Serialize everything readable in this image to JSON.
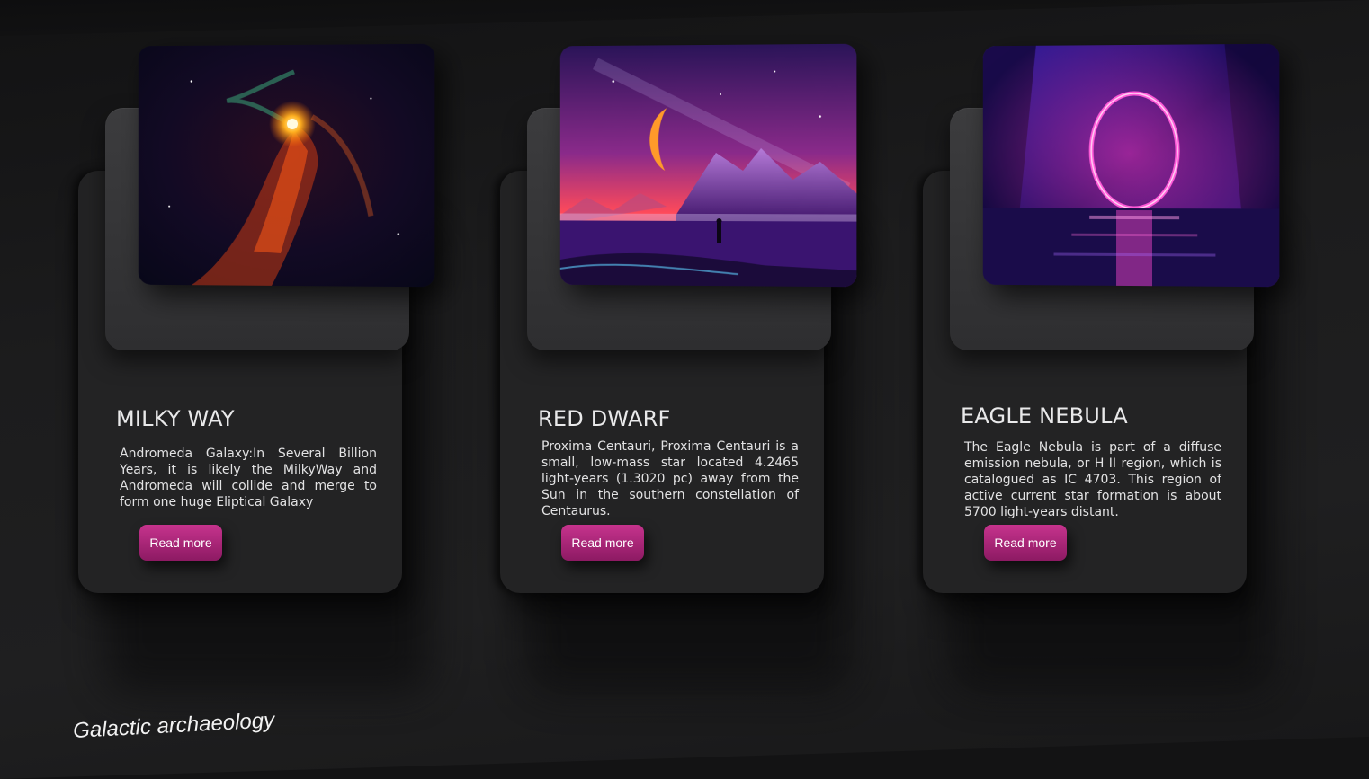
{
  "cards": [
    {
      "title": "MILKY WAY",
      "text": "Andromeda Galaxy:In Several Billion Years, it is likely the MilkyWay and Andromeda will collide and merge to form one huge Eliptical Galaxy",
      "button_label": "Read more",
      "image": "milky-way-image"
    },
    {
      "title": "RED DWARF",
      "text": "Proxima Centauri, Proxima Centauri is a small, low-mass star located 4.2465 light-years (1.3020 pc) away from the Sun in the southern constellation of Centaurus.",
      "button_label": "Read more",
      "image": "red-dwarf-image"
    },
    {
      "title": "EAGLE NEBULA",
      "text": "The Eagle Nebula is part of a diffuse emission nebula, or H II region, which is catalogued as IC 4703. This region of active current star formation is about 5700 light-years distant.",
      "button_label": "Read more",
      "image": "eagle-nebula-image"
    }
  ],
  "caption": "Galactic archaeology",
  "colors": {
    "background": "#1a1a1b",
    "card": "#232324",
    "plate": "#3a3a3c",
    "button": "#b02a7d",
    "text": "#e9e9ea"
  }
}
